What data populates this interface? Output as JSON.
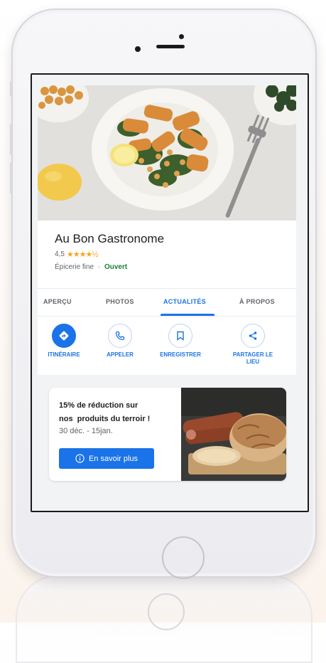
{
  "place": {
    "name": "Au Bon Gastronome",
    "rating": "4,5",
    "stars": "★★★★½",
    "category": "Épicerie fine",
    "separator": "·",
    "status": "Ouvert"
  },
  "tabs": [
    {
      "label": "APERÇU",
      "active": false
    },
    {
      "label": "PHOTOS",
      "active": false
    },
    {
      "label": "ACTUALITÉS",
      "active": true
    },
    {
      "label": "À PROPOS",
      "active": false
    }
  ],
  "actions": [
    {
      "label": "ITINÉRAIRE",
      "icon": "directions-icon"
    },
    {
      "label": "APPELER",
      "icon": "phone-icon"
    },
    {
      "label": "ENREGISTRER",
      "icon": "bookmark-icon"
    },
    {
      "label": "PARTAGER LE LIEU",
      "icon": "share-icon"
    }
  ],
  "promo": {
    "title_line1": "15% de réduction sur",
    "title_line2": "nos  produits du terroir !",
    "dates": "30 déc. - 15jan.",
    "button_label": "En savoir plus",
    "button_icon": "info-icon"
  },
  "colors": {
    "accent": "#1a73e8",
    "open_status": "#188038",
    "stars": "#f4a51c"
  }
}
